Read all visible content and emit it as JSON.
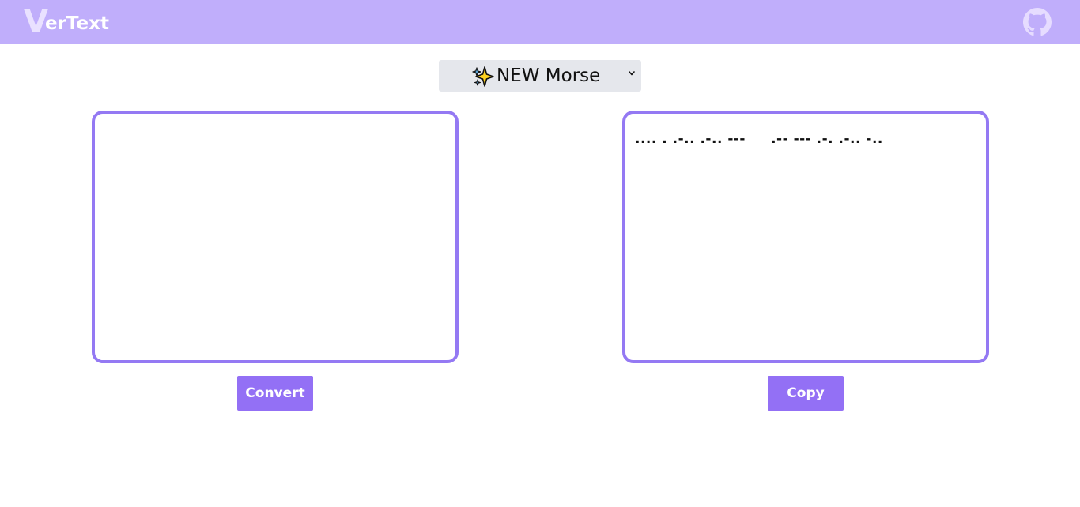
{
  "header": {
    "logo_initial": "V",
    "logo_rest": "erText",
    "github_icon": "github-icon"
  },
  "converter": {
    "selected_mode": "NEW Morse",
    "mode_icon": "sparkle-icon"
  },
  "input": {
    "value": ""
  },
  "output": {
    "value": ".... . .-.. .-.. ---     .-- --- .-. .-.. -.."
  },
  "buttons": {
    "convert_label": "Convert",
    "copy_label": "Copy"
  },
  "colors": {
    "header_bg": "#c0aefb",
    "accent": "#9370f5",
    "border": "#9479f3",
    "select_bg": "#e5e7ec"
  }
}
